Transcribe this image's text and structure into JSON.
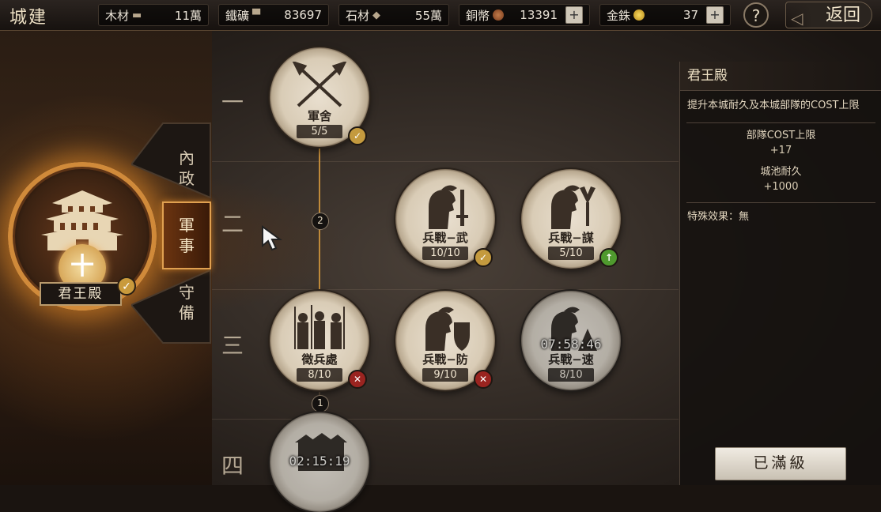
{
  "header": {
    "title": "城建",
    "resources": [
      {
        "label": "木材",
        "icon": "wood-icon",
        "value": "11萬"
      },
      {
        "label": "鐵礦",
        "icon": "iron-icon",
        "value": "83697"
      },
      {
        "label": "石材",
        "icon": "stone-icon",
        "value": "55萬"
      },
      {
        "label": "銅幣",
        "icon": "copper-coin-icon",
        "value": "13391"
      },
      {
        "label": "金銖",
        "icon": "gold-coin-icon",
        "value": "37"
      }
    ],
    "help_label": "?",
    "back_label": "返回"
  },
  "main_building": {
    "name": "君王殿",
    "emblem": "十"
  },
  "tabs": [
    {
      "label_top": "內",
      "label_bottom": "政"
    },
    {
      "label_top": "軍",
      "label_bottom": "事",
      "active": true
    },
    {
      "label_top": "守",
      "label_bottom": "備"
    }
  ],
  "rows": [
    "一",
    "二",
    "三",
    "四"
  ],
  "connectors": [
    "2",
    "1"
  ],
  "buildings": [
    {
      "name": "軍舍",
      "level": "5/5",
      "badge": "check"
    },
    {
      "name": "兵戰−武",
      "level": "10/10",
      "badge": "check"
    },
    {
      "name": "兵戰−謀",
      "level": "5/10",
      "badge": "up"
    },
    {
      "name": "徵兵處",
      "level": "8/10",
      "badge": "no"
    },
    {
      "name": "兵戰−防",
      "level": "9/10",
      "badge": "no"
    },
    {
      "name": "兵戰−速",
      "level": "8/10",
      "timer": "07:58:46"
    },
    {
      "timer": "02:15:19"
    }
  ],
  "info_panel": {
    "title": "君王殿",
    "description": "提升本城耐久及本城部隊的COST上限",
    "stats": [
      {
        "label": "部隊COST上限",
        "value": "+17"
      },
      {
        "label": "城池耐久",
        "value": "+1000"
      }
    ],
    "special_label": "特殊效果：無"
  },
  "max_level_button": "已滿級",
  "colors": {
    "accent": "#d08a3a",
    "check_badge": "#c49a3e",
    "upgrade_badge": "#4f9a2e",
    "locked_badge": "#9a2420"
  }
}
